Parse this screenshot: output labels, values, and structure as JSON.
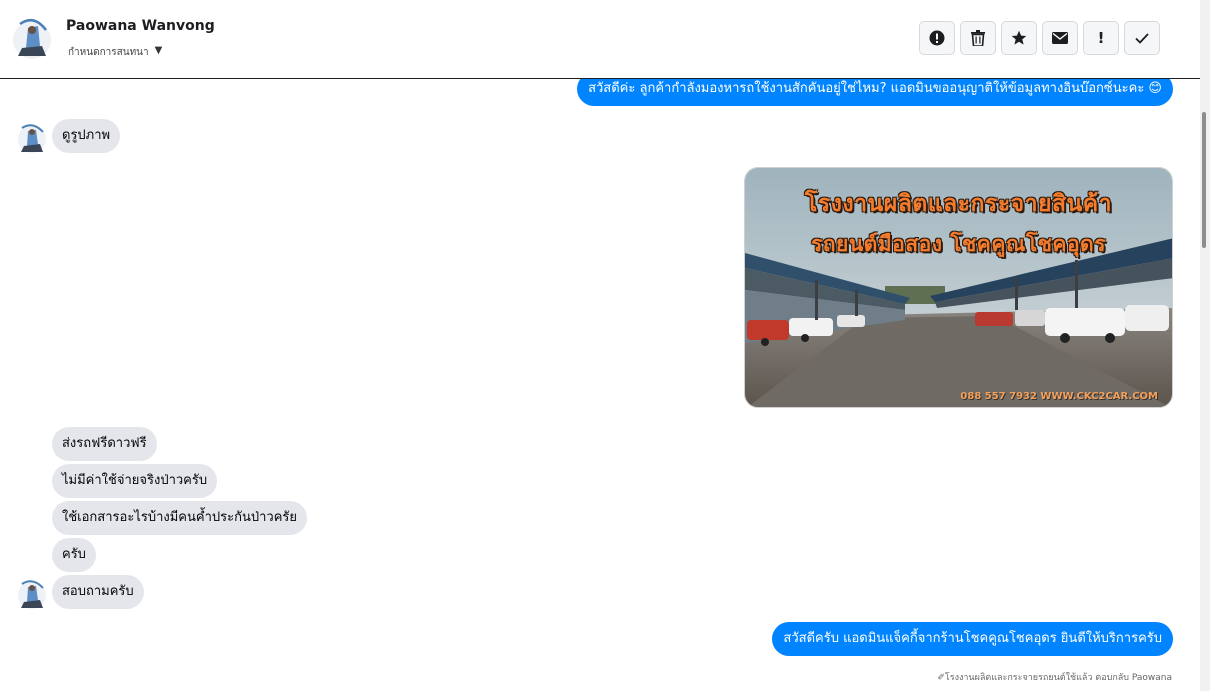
{
  "header": {
    "contact_name": "Paowana Wanvong",
    "assign_label": "กำหนดการสนทนา",
    "actions": [
      {
        "name": "report-spam",
        "icon": "alert-circle-icon"
      },
      {
        "name": "delete",
        "icon": "trash-icon"
      },
      {
        "name": "star",
        "icon": "star-icon"
      },
      {
        "name": "mark-unread",
        "icon": "envelope-icon"
      },
      {
        "name": "follow-up",
        "icon": "exclamation-icon",
        "glyph": "!"
      },
      {
        "name": "mark-done",
        "icon": "checkmark-icon"
      }
    ]
  },
  "messages": {
    "m1": "สวัสดีค่ะ ลูกค้ากำลังมองหารถใช้งานสักคันอยู่ใช่ไหม? แอดมินขออนุญาติให้ข้อมูลทางอินบ๊อกซ์นะคะ 😊",
    "m2": "ดูรูปภาพ",
    "m3": "ส่งรถฟรีดาวฟรี",
    "m4": "ไม่มีค่าใช้จ่ายจริงป่าวครับ",
    "m5": "ใช้เอกสารอะไรบ้างมีคนค้ำประกันป่าวครัย",
    "m6": "ครับ",
    "m7": "สอบถามครับ",
    "m8": "สวัสดีครับ แอดมินแจ็คกี้จากร้านโชคคูณโชคอุดร ยินดีให้บริการครับ"
  },
  "photo": {
    "line1": "โรงงานผลิตและกระจายสินค้า",
    "line2": "รถยนต์มือสอง โชคคูณโชคอุดร",
    "footer": "088 557 7932 WWW.CKC2CAR.COM"
  },
  "footnote": "✐โรงงานผลิตและกระจายรถยนต์ใช้แล้ว ตอบกลับ Paowana",
  "colors": {
    "outgoing_bubble": "#0084ff",
    "incoming_bubble": "#e4e6eb",
    "photo_title": "#f47c2c"
  }
}
